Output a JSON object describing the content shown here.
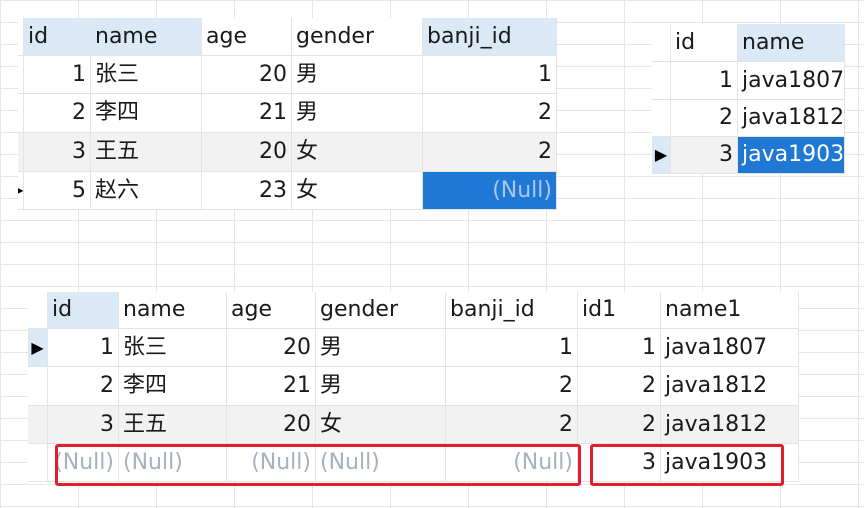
{
  "students_table": {
    "columns": [
      "id",
      "name",
      "age",
      "gender",
      "banji_id"
    ],
    "rows": [
      {
        "id": "1",
        "name": "张三",
        "age": "20",
        "gender": "男",
        "banji_id": "1"
      },
      {
        "id": "2",
        "name": "李四",
        "age": "21",
        "gender": "男",
        "banji_id": "2"
      },
      {
        "id": "3",
        "name": "王五",
        "age": "20",
        "gender": "女",
        "banji_id": "2"
      },
      {
        "id": "5",
        "name": "赵六",
        "age": "23",
        "gender": "女",
        "banji_id": "(Null)"
      }
    ]
  },
  "banji_table": {
    "columns": [
      "id",
      "name"
    ],
    "rows": [
      {
        "id": "1",
        "name": "java1807"
      },
      {
        "id": "2",
        "name": "java1812"
      },
      {
        "id": "3",
        "name": "java1903"
      }
    ]
  },
  "join_table": {
    "columns": [
      "id",
      "name",
      "age",
      "gender",
      "banji_id",
      "id1",
      "name1"
    ],
    "rows": [
      {
        "id": "1",
        "name": "张三",
        "age": "20",
        "gender": "男",
        "banji_id": "1",
        "id1": "1",
        "name1": "java1807"
      },
      {
        "id": "2",
        "name": "李四",
        "age": "21",
        "gender": "男",
        "banji_id": "2",
        "id1": "2",
        "name1": "java1812"
      },
      {
        "id": "3",
        "name": "王五",
        "age": "20",
        "gender": "女",
        "banji_id": "2",
        "id1": "2",
        "name1": "java1812"
      },
      {
        "id": "(Null)",
        "name": "(Null)",
        "age": "(Null)",
        "gender": "(Null)",
        "banji_id": "(Null)",
        "id1": "3",
        "name1": "java1903"
      }
    ]
  },
  "icons": {
    "row_pointer": "▶"
  },
  "colors": {
    "selection": "#1e78d4",
    "header_selected": "#dbe8f6",
    "highlight_box": "#e0202c",
    "null_text": "#a9afbf"
  }
}
